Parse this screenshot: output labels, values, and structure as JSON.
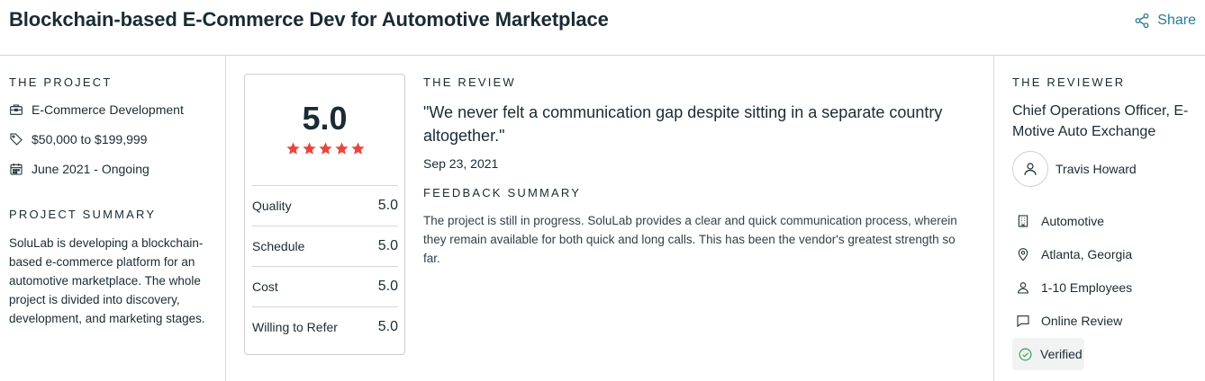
{
  "header": {
    "title": "Blockchain-based E-Commerce Dev for Automotive Marketplace",
    "share_label": "Share"
  },
  "project": {
    "section_label": "THE PROJECT",
    "service": "E-Commerce Development",
    "budget": "$50,000 to $199,999",
    "timeline": "June 2021 - Ongoing",
    "summary_label": "PROJECT SUMMARY",
    "summary_text": "SoluLab is developing a blockchain-based e-commerce platform for an automotive marketplace. The whole project is divided into discovery, development, and marketing stages."
  },
  "rating": {
    "overall": "5.0",
    "stars": 5,
    "star_color": "#e5473f",
    "scores": [
      {
        "name": "Quality",
        "value": "5.0"
      },
      {
        "name": "Schedule",
        "value": "5.0"
      },
      {
        "name": "Cost",
        "value": "5.0"
      },
      {
        "name": "Willing to Refer",
        "value": "5.0"
      }
    ]
  },
  "review": {
    "section_label": "THE REVIEW",
    "quote": "\"We never felt a communication gap despite sitting in a separate country altogether.\"",
    "date": "Sep 23, 2021",
    "feedback_label": "FEEDBACK SUMMARY",
    "feedback_text": "The project is still in progress. SoluLab provides a clear and quick communication process, wherein they remain available for both quick and long calls. This has been the vendor's greatest strength so far."
  },
  "reviewer": {
    "section_label": "THE REVIEWER",
    "title": "Chief Operations Officer, E-Motive Auto Exchange",
    "name": "Travis Howard",
    "industry": "Automotive",
    "location": "Atlanta, Georgia",
    "company_size": "1-10 Employees",
    "review_type": "Online Review",
    "verified_label": "Verified"
  },
  "colors": {
    "accent": "#2b7a9c",
    "verified_green": "#3a9b5a"
  }
}
